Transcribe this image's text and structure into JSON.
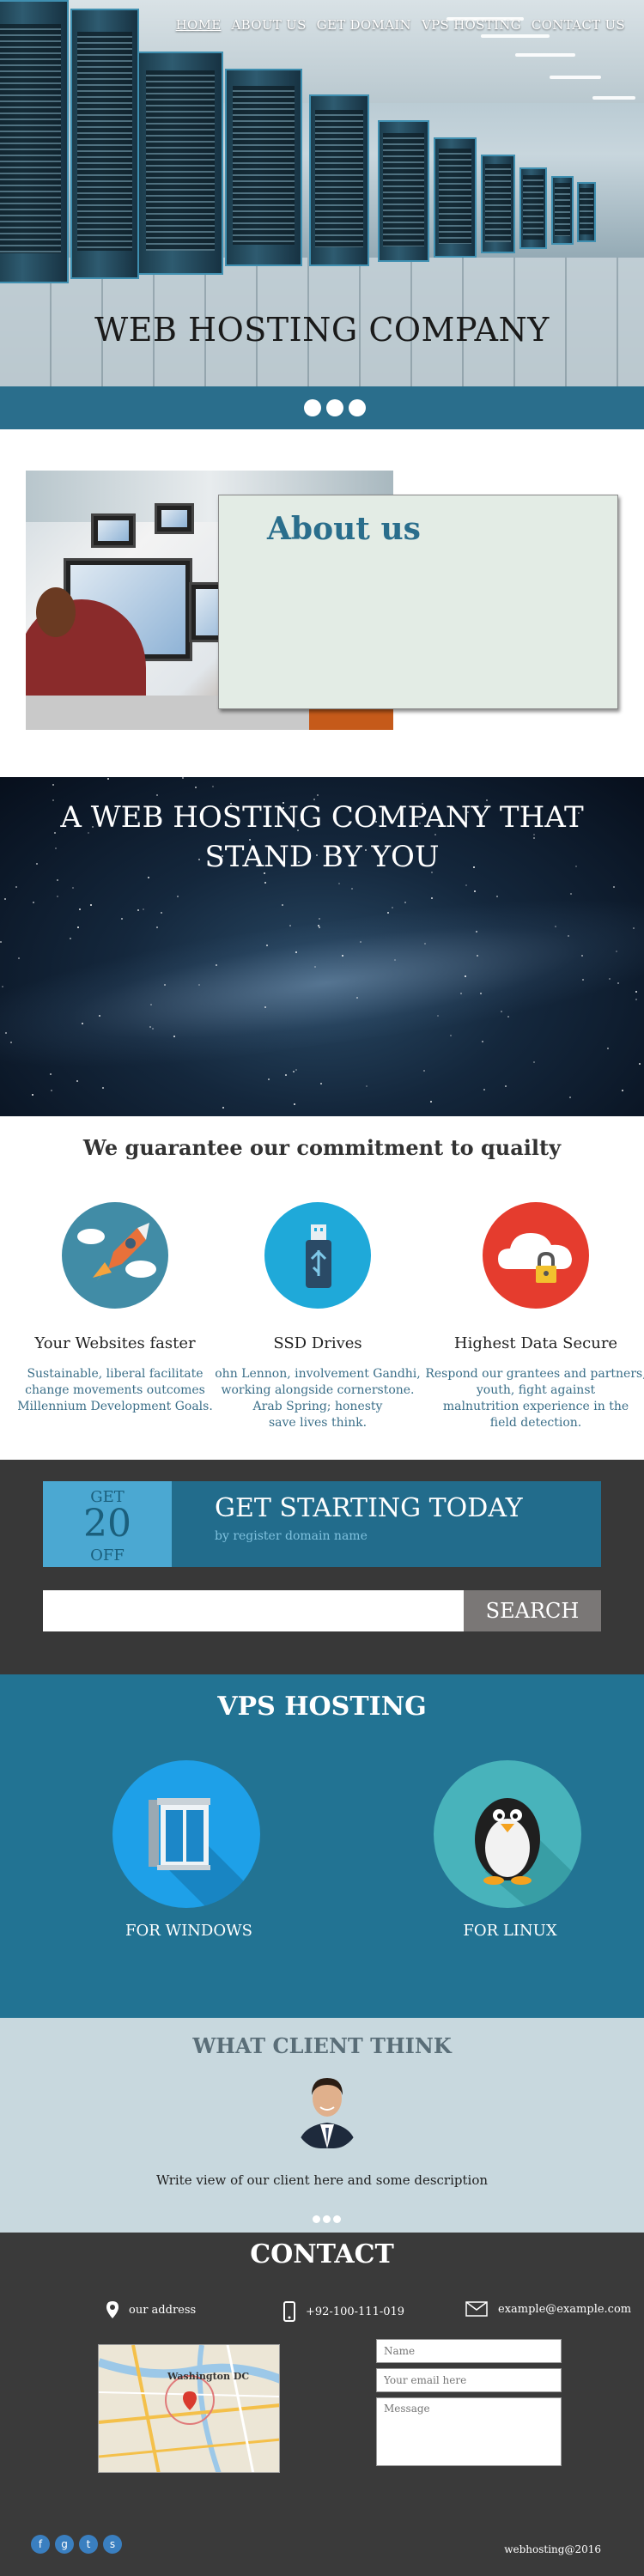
{
  "nav": {
    "items": [
      "HOME",
      "ABOUT US",
      "GET DOMAIN",
      "VPS HOSTING",
      "CONTACT US"
    ]
  },
  "hero": {
    "title": "WEB HOSTING COMPANY"
  },
  "about": {
    "title": "About us"
  },
  "tagline": {
    "line1": "A WEB HOSTING COMPANY THAT",
    "line2": "STAND BY YOU"
  },
  "features": {
    "title": "We guarantee our commitment to quailty",
    "items": [
      {
        "icon": "rocket-icon",
        "title": "Your Websites faster",
        "desc": [
          "Sustainable, liberal facilitate",
          "change movements outcomes",
          "Millennium Development Goals."
        ]
      },
      {
        "icon": "usb-drive-icon",
        "title": "SSD Drives",
        "desc": [
          "ohn Lennon, involvement Gandhi,",
          "working alongside cornerstone.",
          "Arab Spring; honesty",
          "save lives think."
        ]
      },
      {
        "icon": "cloud-lock-icon",
        "title": "Highest Data Secure",
        "desc": [
          "Respond our grantees and partners,",
          "youth,  fight against",
          "malnutrition experience in the",
          "field detection."
        ]
      }
    ]
  },
  "getstarted": {
    "badge_get": "GET",
    "badge_num": "20",
    "badge_off": "OFF",
    "title": "GET STARTING TODAY",
    "subtitle": "by register domain name",
    "search_label": "SEARCH"
  },
  "vps": {
    "title": "VPS HOSTING",
    "windows_label": "FOR WINDOWS",
    "linux_label": "FOR LINUX"
  },
  "client": {
    "title": "WHAT CLIENT THINK",
    "text": "Write view of our client here and some description"
  },
  "contact": {
    "title": "CONTACT",
    "address": "our address",
    "phone": "+92-100-111-019",
    "email": "example@example.com",
    "name_placeholder": "Name",
    "email_placeholder": "Your email here",
    "message_placeholder": "Message",
    "map_label": "Washington DC",
    "copyright": "webhosting@2016"
  },
  "colors": {
    "primary": "#2a6e8c",
    "vps_bg": "#227393",
    "dark": "#3a3a3a",
    "badge": "#4ba8d2",
    "client_bg": "#c8d8de",
    "about_box": "#e3ece5"
  }
}
